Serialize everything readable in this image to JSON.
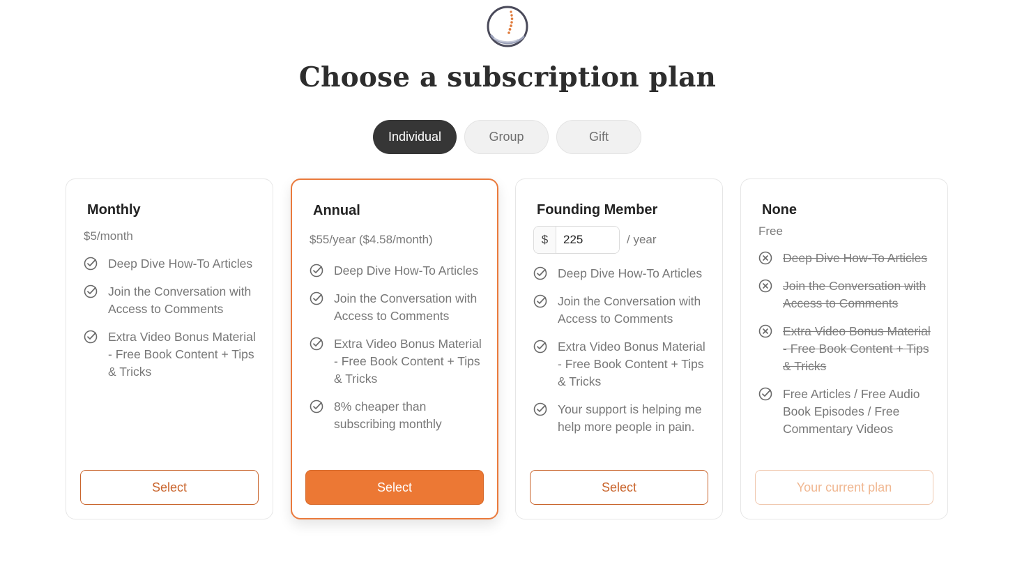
{
  "page": {
    "title": "Choose a subscription plan",
    "logo_icon": "spine-in-hand-logo",
    "accent_color": "#ec7834"
  },
  "tabs": [
    {
      "label": "Individual",
      "active": true
    },
    {
      "label": "Group",
      "active": false
    },
    {
      "label": "Gift",
      "active": false
    }
  ],
  "plans": [
    {
      "name": "Monthly",
      "price": "$5/month",
      "features": [
        {
          "text": "Deep Dive How-To Articles",
          "icon": "check-circle-icon"
        },
        {
          "text": "Join the Conversation with Access to Comments",
          "icon": "check-circle-icon"
        },
        {
          "text": "Extra Video Bonus Material - Free Book Content + Tips & Tricks",
          "icon": "check-circle-icon"
        }
      ],
      "button_label": "Select",
      "button_style": "outline"
    },
    {
      "name": "Annual",
      "price": "$55/year ($4.58/month)",
      "featured": true,
      "features": [
        {
          "text": "Deep Dive How-To Articles",
          "icon": "check-circle-icon"
        },
        {
          "text": "Join the Conversation with Access to Comments",
          "icon": "check-circle-icon"
        },
        {
          "text": "Extra Video Bonus Material - Free Book Content + Tips & Tricks",
          "icon": "check-circle-icon"
        },
        {
          "text": "8% cheaper than subscribing monthly",
          "icon": "check-circle-icon"
        }
      ],
      "button_label": "Select",
      "button_style": "filled"
    },
    {
      "name": "Founding Member",
      "amount_prefix": "$",
      "amount_value": "225",
      "amount_suffix": "/ year",
      "features": [
        {
          "text": "Deep Dive How-To Articles",
          "icon": "check-circle-icon"
        },
        {
          "text": "Join the Conversation with Access to Comments",
          "icon": "check-circle-icon"
        },
        {
          "text": "Extra Video Bonus Material - Free Book Content + Tips & Tricks",
          "icon": "check-circle-icon"
        },
        {
          "text": "Your support is helping me help more people in pain.",
          "icon": "check-circle-icon"
        }
      ],
      "button_label": "Select",
      "button_style": "outline"
    },
    {
      "name": "None",
      "price": "Free",
      "features": [
        {
          "text": "Deep Dive How-To Articles",
          "icon": "x-circle-icon",
          "excluded": true
        },
        {
          "text": "Join the Conversation with Access to Comments",
          "icon": "x-circle-icon",
          "excluded": true
        },
        {
          "text": "Extra Video Bonus Material - Free Book Content + Tips & Tricks",
          "icon": "x-circle-icon",
          "excluded": true
        },
        {
          "text": "Free Articles / Free Audio Book Episodes / Free Commentary Videos",
          "icon": "check-circle-icon"
        }
      ],
      "button_label": "Your current plan",
      "button_style": "disabled"
    }
  ]
}
